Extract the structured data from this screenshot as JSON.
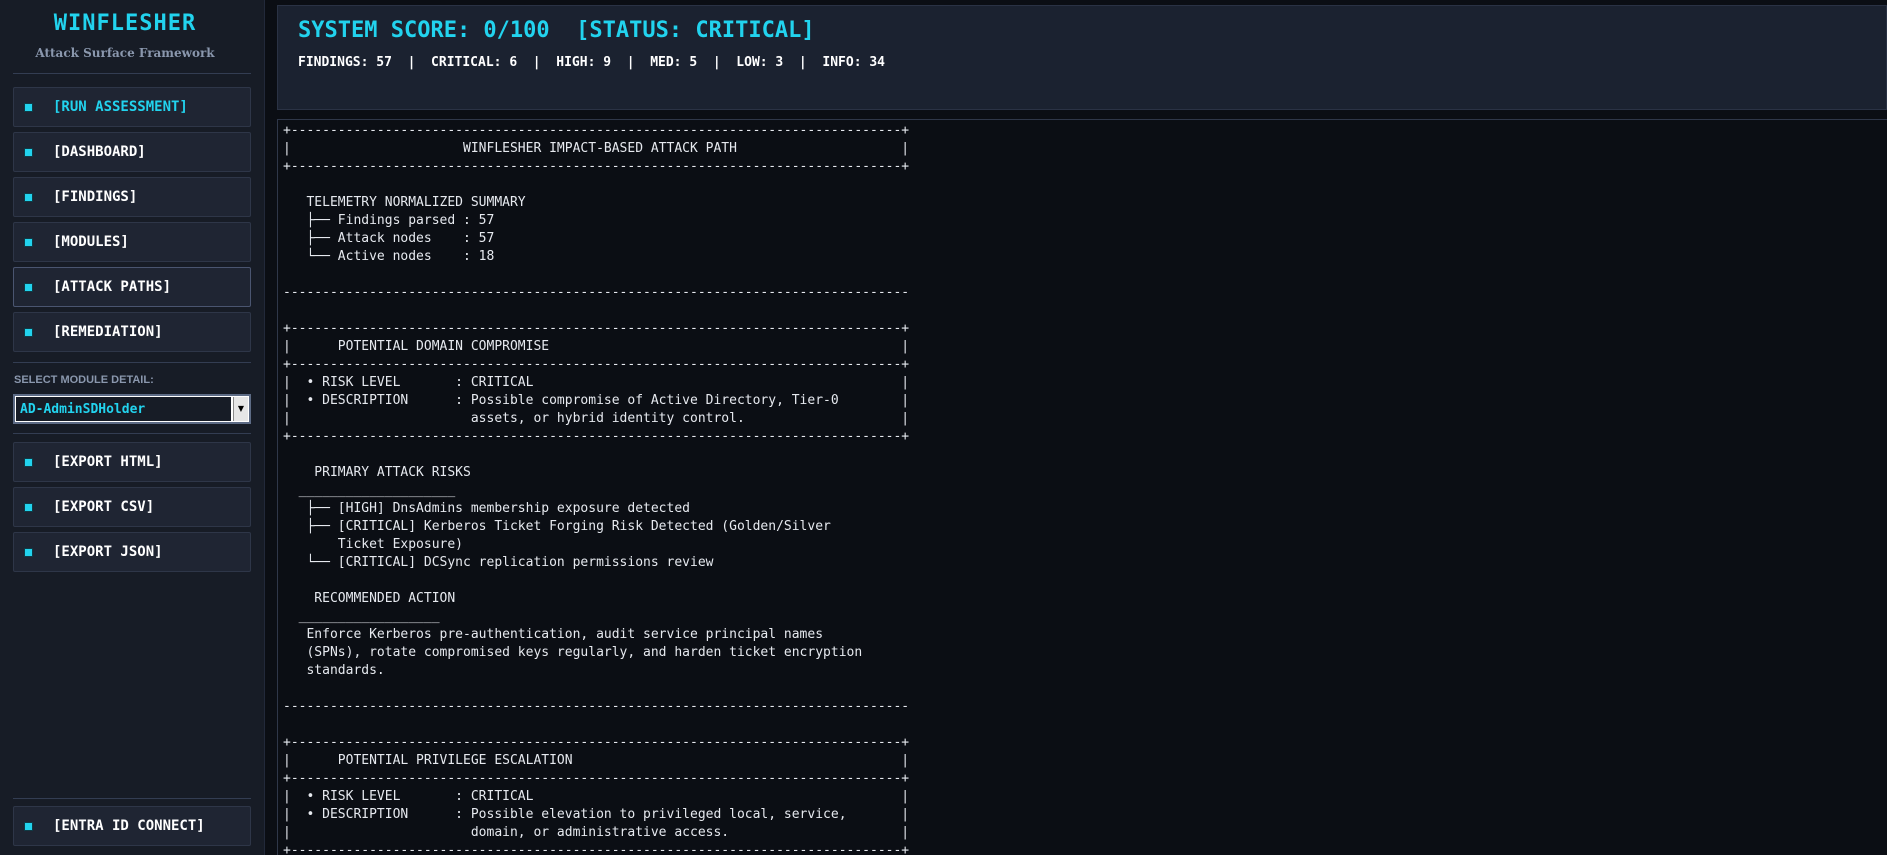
{
  "app": {
    "title": "WINFLESHER",
    "subtitle": "Attack Surface Framework"
  },
  "sidebar": {
    "nav": [
      {
        "label": "[RUN ASSESSMENT]"
      },
      {
        "label": "[DASHBOARD]"
      },
      {
        "label": "[FINDINGS]"
      },
      {
        "label": "[MODULES]"
      },
      {
        "label": "[ATTACK PATHS]"
      },
      {
        "label": "[REMEDIATION]"
      }
    ],
    "select_label": "SELECT MODULE DETAIL:",
    "select_value": "AD-AdminSDHolder",
    "export": [
      {
        "label": "[EXPORT HTML]"
      },
      {
        "label": "[EXPORT CSV]"
      },
      {
        "label": "[EXPORT JSON]"
      }
    ],
    "connect_label": "[ENTRA ID CONNECT]"
  },
  "header": {
    "score_line": "SYSTEM SCORE: 0/100  [STATUS: CRITICAL]",
    "summary_line": "FINDINGS: 57  |  CRITICAL: 6  |  HIGH: 9  |  MED: 5  |  LOW: 3  |  INFO: 34"
  },
  "report": {
    "lines": [
      "+------------------------------------------------------------------------------+",
      "|                      WINFLESHER IMPACT-BASED ATTACK PATH                     |",
      "+------------------------------------------------------------------------------+",
      "",
      "   TELEMETRY NORMALIZED SUMMARY",
      "   ├── Findings parsed : 57",
      "   ├── Attack nodes    : 57",
      "   └── Active nodes    : 18",
      "",
      "--------------------------------------------------------------------------------",
      "",
      "+------------------------------------------------------------------------------+",
      "|      POTENTIAL DOMAIN COMPROMISE                                             |",
      "+------------------------------------------------------------------------------+",
      "|  • RISK LEVEL       : CRITICAL                                               |",
      "|  • DESCRIPTION      : Possible compromise of Active Directory, Tier-0        |",
      "|                       assets, or hybrid identity control.                    |",
      "+------------------------------------------------------------------------------+",
      "",
      "    PRIMARY ATTACK RISKS",
      "  ____________________",
      "   ├── [HIGH] DnsAdmins membership exposure detected",
      "   ├── [CRITICAL] Kerberos Ticket Forging Risk Detected (Golden/Silver",
      "       Ticket Exposure)",
      "   └── [CRITICAL] DCSync replication permissions review",
      "",
      "    RECOMMENDED ACTION",
      "  __________________",
      "   Enforce Kerberos pre-authentication, audit service principal names",
      "   (SPNs), rotate compromised keys regularly, and harden ticket encryption",
      "   standards.",
      "",
      "--------------------------------------------------------------------------------",
      "",
      "+------------------------------------------------------------------------------+",
      "|      POTENTIAL PRIVILEGE ESCALATION                                          |",
      "+------------------------------------------------------------------------------+",
      "|  • RISK LEVEL       : CRITICAL                                               |",
      "|  • DESCRIPTION      : Possible elevation to privileged local, service,       |",
      "|                       domain, or administrative access.                      |",
      "+------------------------------------------------------------------------------+"
    ]
  },
  "colors": {
    "accent": "#22d3ee",
    "sidebar_bg": "#171c26",
    "panel_bg": "#1b2230",
    "report_bg": "#0b0e14"
  }
}
